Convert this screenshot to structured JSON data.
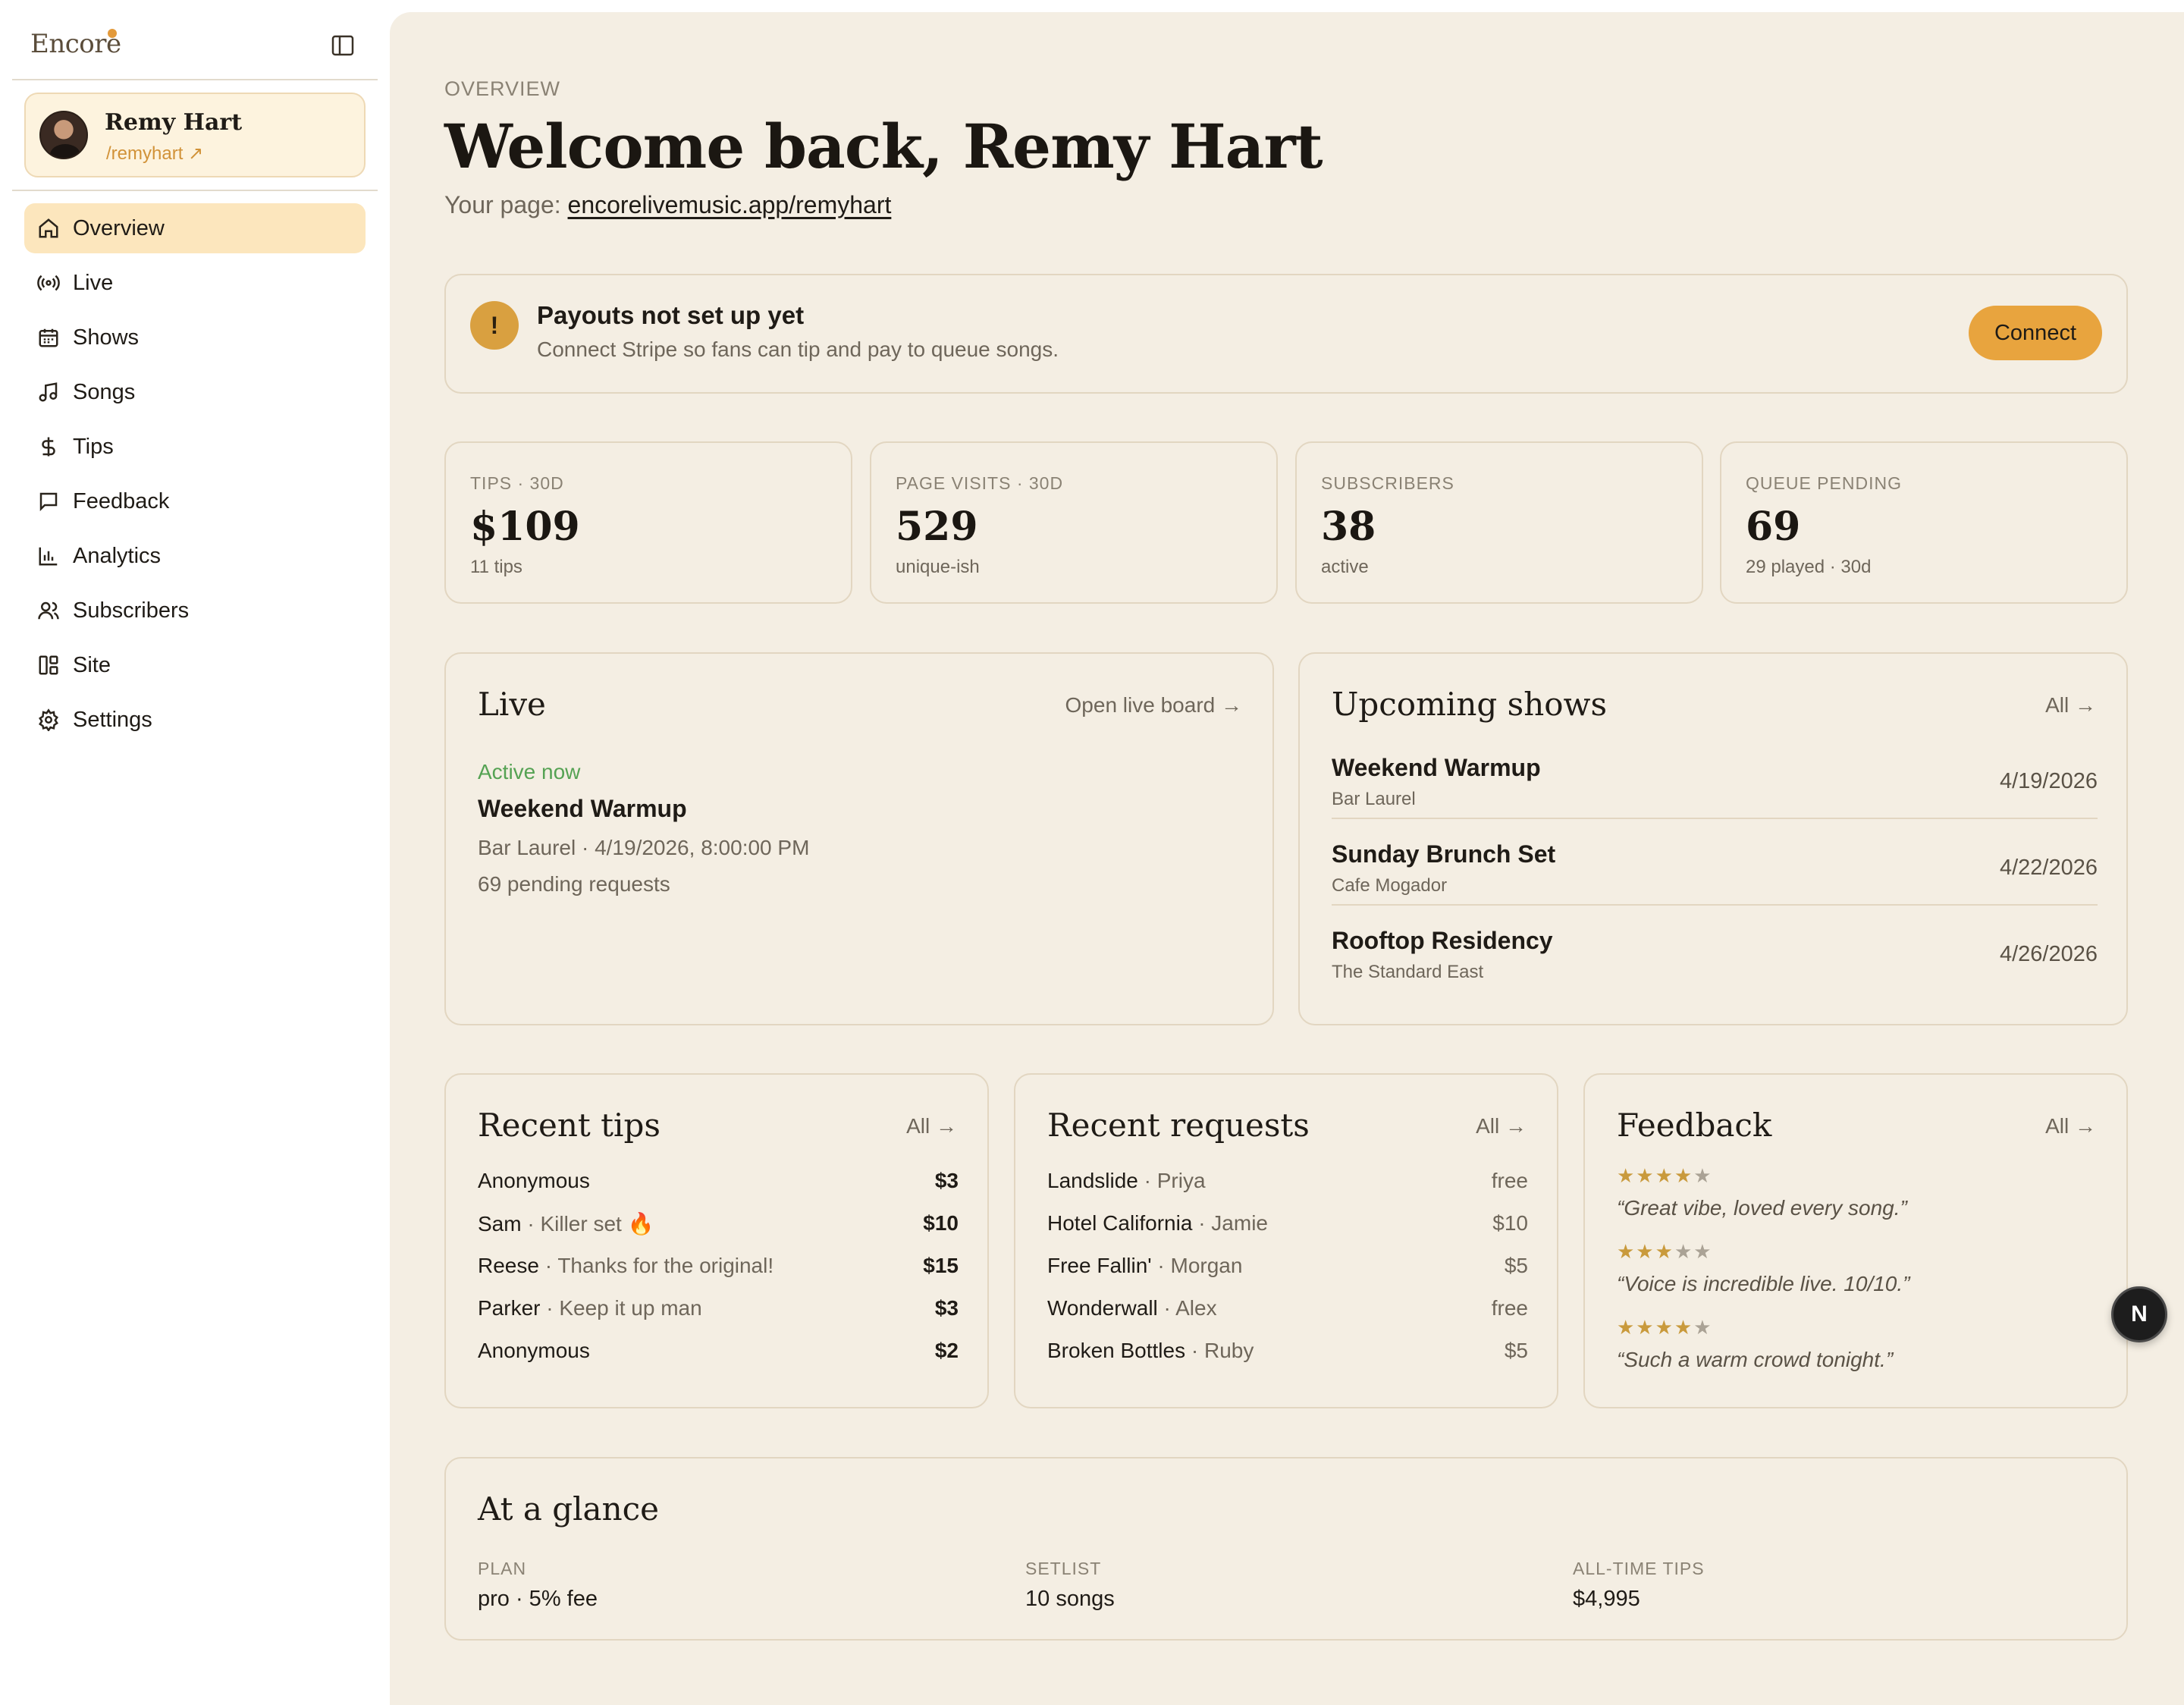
{
  "brand": {
    "name": "Encore"
  },
  "profile": {
    "name": "Remy Hart",
    "handle": "/remyhart ↗"
  },
  "nav": [
    {
      "label": "Overview",
      "icon": "home-icon",
      "active": true
    },
    {
      "label": "Live",
      "icon": "broadcast-icon"
    },
    {
      "label": "Shows",
      "icon": "calendar-icon"
    },
    {
      "label": "Songs",
      "icon": "music-note-icon"
    },
    {
      "label": "Tips",
      "icon": "dollar-icon"
    },
    {
      "label": "Feedback",
      "icon": "message-icon"
    },
    {
      "label": "Analytics",
      "icon": "bar-chart-icon"
    },
    {
      "label": "Subscribers",
      "icon": "users-icon"
    },
    {
      "label": "Site",
      "icon": "layout-icon"
    },
    {
      "label": "Settings",
      "icon": "gear-icon"
    }
  ],
  "header": {
    "eyebrow": "OVERVIEW",
    "title": "Welcome back, Remy Hart",
    "page_prefix": "Your page: ",
    "page_url": "encorelivemusic.app/remyhart"
  },
  "payout": {
    "title": "Payouts not set up yet",
    "subtitle": "Connect Stripe so fans can tip and pay to queue songs.",
    "button": "Connect",
    "icon_glyph": "!"
  },
  "stats": [
    {
      "label": "TIPS · 30D",
      "value": "$109",
      "sub": "11 tips"
    },
    {
      "label": "PAGE VISITS · 30D",
      "value": "529",
      "sub": "unique-ish"
    },
    {
      "label": "SUBSCRIBERS",
      "value": "38",
      "sub": "active"
    },
    {
      "label": "QUEUE PENDING",
      "value": "69",
      "sub": "29 played · 30d"
    }
  ],
  "live": {
    "title": "Live",
    "link": "Open live board →",
    "status": "Active now",
    "show": "Weekend Warmup",
    "meta": "Bar Laurel · 4/19/2026, 8:00:00 PM",
    "pending": "69 pending requests"
  },
  "upcoming": {
    "title": "Upcoming shows",
    "link": "All →",
    "shows": [
      {
        "name": "Weekend Warmup",
        "venue": "Bar Laurel",
        "date": "4/19/2026"
      },
      {
        "name": "Sunday Brunch Set",
        "venue": "Cafe Mogador",
        "date": "4/22/2026"
      },
      {
        "name": "Rooftop Residency",
        "venue": "The Standard East",
        "date": "4/26/2026"
      }
    ]
  },
  "recent_tips": {
    "title": "Recent tips",
    "link": "All →",
    "rows": [
      {
        "name": "Anonymous",
        "note": "",
        "amount": "$3"
      },
      {
        "name": "Sam",
        "note": " · Killer set 🔥",
        "amount": "$10"
      },
      {
        "name": "Reese",
        "note": " · Thanks for the original!",
        "amount": "$15"
      },
      {
        "name": "Parker",
        "note": " · Keep it up man",
        "amount": "$3"
      },
      {
        "name": "Anonymous",
        "note": "",
        "amount": "$2"
      }
    ]
  },
  "recent_requests": {
    "title": "Recent requests",
    "link": "All →",
    "rows": [
      {
        "song": "Landslide",
        "who": " · Priya",
        "amount": "free"
      },
      {
        "song": "Hotel California",
        "who": " · Jamie",
        "amount": "$10"
      },
      {
        "song": "Free Fallin'",
        "who": " · Morgan",
        "amount": "$5"
      },
      {
        "song": "Wonderwall",
        "who": " · Alex",
        "amount": "free"
      },
      {
        "song": "Broken Bottles",
        "who": " · Ruby",
        "amount": "$5"
      }
    ]
  },
  "feedback": {
    "title": "Feedback",
    "link": "All →",
    "items": [
      {
        "stars": 4,
        "quote": "“Great vibe, loved every song.”"
      },
      {
        "stars": 3,
        "quote": "“Voice is incredible live. 10/10.”"
      },
      {
        "stars": 4,
        "quote": "“Such a warm crowd tonight.”"
      }
    ]
  },
  "glance": {
    "title": "At a glance",
    "cols": [
      {
        "label": "PLAN",
        "value": "pro · 5% fee"
      },
      {
        "label": "SETLIST",
        "value": "10 songs"
      },
      {
        "label": "ALL-TIME TIPS",
        "value": "$4,995"
      }
    ]
  },
  "fab": {
    "glyph": "N"
  },
  "colors": {
    "accent": "#e8a43e",
    "panel": "#f4eee3",
    "active_nav": "#fce6bd",
    "live_green": "#55a253"
  }
}
